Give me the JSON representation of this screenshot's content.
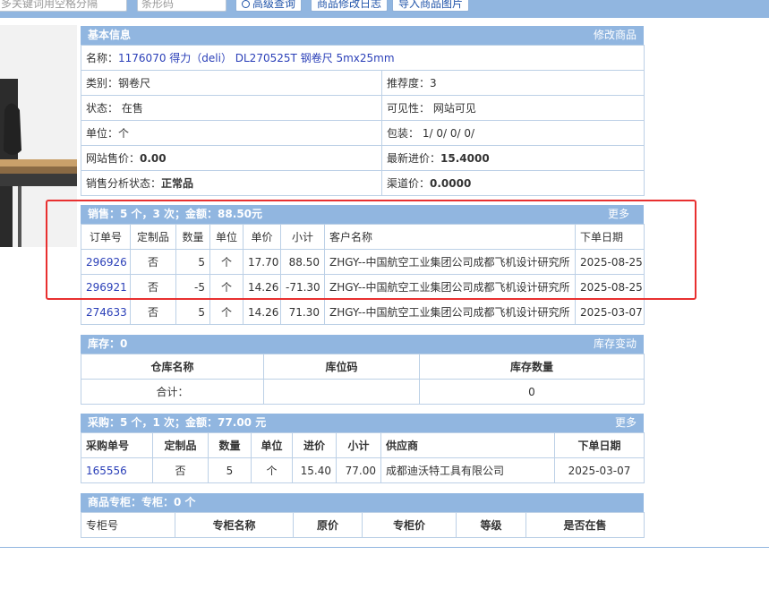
{
  "toolbar": {
    "keyword_placeholder": "多关键词用空格分隔",
    "barcode_placeholder": "条形码",
    "advanced_search": "高级查询",
    "modify_log": "商品修改日志",
    "import_images": "导入商品图片"
  },
  "basic": {
    "title": "基本信息",
    "edit_link": "修改商品",
    "name_label": "名称：",
    "name_value": "1176070 得力（deli） DL270525T 钢卷尺 5mx25mm",
    "category_label": "类别：",
    "category_value": "钢卷尺",
    "recommend_label": "推荐度：",
    "recommend_value": "3",
    "status_label": "状态：",
    "status_value": "在售",
    "visibility_label": "可见性：",
    "visibility_value": "网站可见",
    "unit_label": "单位：",
    "unit_value": "个",
    "pack_label": "包装：",
    "pack_value": "1/ 0/ 0/ 0/",
    "web_price_label": "网站售价：",
    "web_price_value": "0.00",
    "latest_cost_label": "最新进价：",
    "latest_cost_value": "15.4000",
    "sales_status_label": "销售分析状态：",
    "sales_status_value": "正常品",
    "channel_price_label": "渠道价：",
    "channel_price_value": "0.0000"
  },
  "sales": {
    "summary": "销售：5 个，3 次；金额：88.50元",
    "more": "更多",
    "headers": [
      "订单号",
      "定制品",
      "数量",
      "单位",
      "单价",
      "小计",
      "客户名称",
      "下单日期"
    ],
    "rows": [
      [
        "296926",
        "否",
        "5",
        "个",
        "17.70",
        "88.50",
        "ZHGY--中国航空工业集团公司成都飞机设计研究所",
        "2025-08-25"
      ],
      [
        "296921",
        "否",
        "-5",
        "个",
        "14.26",
        "-71.30",
        "ZHGY--中国航空工业集团公司成都飞机设计研究所",
        "2025-08-25"
      ],
      [
        "274633",
        "否",
        "5",
        "个",
        "14.26",
        "71.30",
        "ZHGY--中国航空工业集团公司成都飞机设计研究所",
        "2025-03-07"
      ]
    ]
  },
  "inventory": {
    "summary": "库存：0",
    "change_link": "库存变动",
    "headers": [
      "仓库名称",
      "库位码",
      "库存数量"
    ],
    "total_label": "合计：",
    "total_location": "",
    "total_qty": "0"
  },
  "purchase": {
    "summary": "采购：5 个，1 次；金额：77.00 元",
    "more": "更多",
    "headers": [
      "采购单号",
      "定制品",
      "数量",
      "单位",
      "进价",
      "小计",
      "供应商",
      "下单日期"
    ],
    "rows": [
      [
        "165556",
        "否",
        "5",
        "个",
        "15.40",
        "77.00",
        "成都迪沃特工具有限公司",
        "2025-03-07"
      ]
    ]
  },
  "counter": {
    "summary": "商品专柜：专柜：0 个",
    "headers": [
      "专柜号",
      "专柜名称",
      "原价",
      "专柜价",
      "等级",
      "是否在售"
    ]
  },
  "colors": {
    "header_bg": "#91b6e0",
    "link": "#2a3fb8",
    "highlight": "#e83030"
  }
}
